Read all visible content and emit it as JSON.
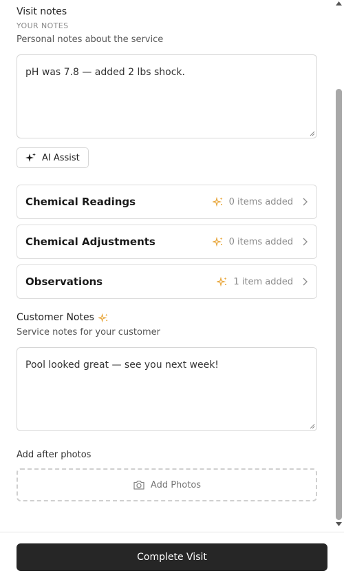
{
  "visit_notes": {
    "title": "Visit notes",
    "caps_label": "YOUR NOTES",
    "description": "Personal notes about the service",
    "value": "pH was 7.8 — added 2 lbs shock."
  },
  "ai_assist": {
    "label": "AI Assist",
    "icon": "sparkles-icon"
  },
  "sections": [
    {
      "title": "Chemical Readings",
      "count": "0 items added"
    },
    {
      "title": "Chemical Adjustments",
      "count": "0 items added"
    },
    {
      "title": "Observations",
      "count": "1 item added"
    }
  ],
  "customer_notes": {
    "title": "Customer Notes",
    "description": "Service notes for your customer",
    "value": "Pool looked great — see you next week!"
  },
  "photos": {
    "title": "Add after photos",
    "button_label": "Add Photos",
    "icon": "camera-icon"
  },
  "footer": {
    "complete_label": "Complete Visit"
  },
  "colors": {
    "accent_spark": "#e8a63a",
    "primary_button": "#262626",
    "border": "#d6d6d6"
  }
}
